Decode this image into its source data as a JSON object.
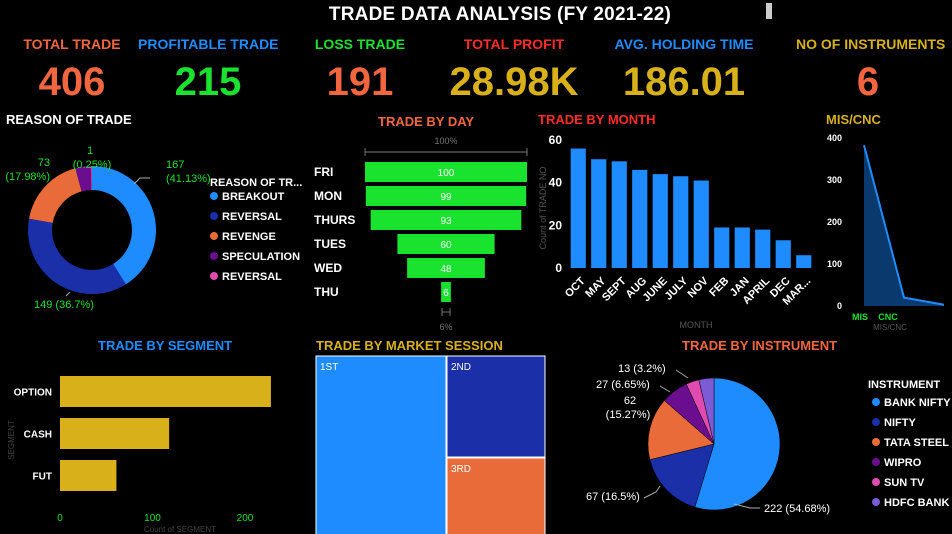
{
  "header": {
    "title": "TRADE DATA ANALYSIS (FY 2021-22)"
  },
  "kpis": [
    {
      "label": "TOTAL TRADE",
      "value": "406",
      "label_color": "#f2663f",
      "value_color": "#f2663f"
    },
    {
      "label": "PROFITABLE TRADE",
      "value": "215",
      "label_color": "#1e8cff",
      "value_color": "#19e32e"
    },
    {
      "label": "LOSS TRADE",
      "value": "191",
      "label_color": "#19e32e",
      "value_color": "#f2663f"
    },
    {
      "label": "TOTAL PROFIT",
      "value": "28.98K",
      "label_color": "#ff2b2b",
      "value_color": "#d8b11a"
    },
    {
      "label": "AVG. HOLDING TIME",
      "value": "186.01",
      "label_color": "#1e8cff",
      "value_color": "#d8b11a"
    },
    {
      "label": "NO OF INSTRUMENTS",
      "value": "6",
      "label_color": "#d8b11a",
      "value_color": "#f2663f"
    }
  ],
  "panels": {
    "reason_title": "REASON OF TRADE",
    "day_title": "TRADE BY DAY",
    "month_title": "TRADE BY MONTH",
    "mis_title": "MIS/CNC",
    "segment_title": "TRADE BY SEGMENT",
    "session_title": "TRADE BY MARKET SESSION",
    "instrument_title": "TRADE BY INSTRUMENT"
  },
  "chart_data": [
    {
      "id": "reason",
      "type": "pie",
      "title": "REASON OF TRADE",
      "legend_title": "REASON OF TR...",
      "slices": [
        {
          "name": "BREAKOUT",
          "value": 167,
          "label": "167 (41.13%)",
          "color": "#1e8cff"
        },
        {
          "name": "REVERSAL",
          "value": 149,
          "label": "149 (36.7%)",
          "color": "#1a2fa8"
        },
        {
          "name": "REVENGE",
          "value": 73,
          "label": "73 (17.98%)",
          "color": "#ea6b3a"
        },
        {
          "name": "SPECULATION",
          "value": 16,
          "label": "",
          "color": "#6a0d8f"
        },
        {
          "name": "REVERSAL",
          "value": 1,
          "label": "1 (0.25%)",
          "color": "#e04bb0"
        }
      ]
    },
    {
      "id": "day",
      "type": "bar",
      "title": "TRADE BY DAY",
      "top_label": "100%",
      "bottom_label": "6%",
      "categories": [
        "FRI",
        "MON",
        "THURS",
        "TUES",
        "WED",
        "THU"
      ],
      "values": [
        100,
        99,
        93,
        60,
        48,
        6
      ]
    },
    {
      "id": "month",
      "type": "bar",
      "title": "TRADE BY MONTH",
      "xlabel": "MONTH",
      "ylabel": "Count of TRADE NO",
      "ylim": [
        0,
        60
      ],
      "yticks": [
        "0",
        "20",
        "40",
        "60"
      ],
      "categories": [
        "OCT",
        "MAY",
        "SEPT",
        "AUG",
        "JUNE",
        "JULY",
        "NOV",
        "FEB",
        "JAN",
        "APRIL",
        "DEC",
        "MAR..."
      ],
      "values": [
        56,
        51,
        50,
        46,
        44,
        43,
        41,
        19,
        19,
        18,
        13,
        6
      ]
    },
    {
      "id": "miscnc",
      "type": "area",
      "title": "MIS/CNC",
      "xlabel": "MIS/CNC",
      "ylim": [
        0,
        400
      ],
      "yticks": [
        "0",
        "100",
        "200",
        "300",
        "400"
      ],
      "categories": [
        "MIS",
        "CNC",
        ""
      ],
      "values": [
        383,
        20,
        3
      ]
    },
    {
      "id": "segment",
      "type": "bar",
      "title": "TRADE BY SEGMENT",
      "xlabel": "Count of SEGMENT",
      "ylabel": "SEGMENT",
      "xlim": [
        0,
        240
      ],
      "xticks": [
        "0",
        "100",
        "200"
      ],
      "categories": [
        "OPTION",
        "CASH",
        "FUT"
      ],
      "values": [
        228,
        118,
        61
      ]
    },
    {
      "id": "session",
      "type": "heatmap",
      "title": "TRADE BY MARKET SESSION",
      "cells": [
        {
          "name": "1ST",
          "color": "#1e8cff"
        },
        {
          "name": "2ND",
          "color": "#1a2fa8"
        },
        {
          "name": "3RD",
          "color": "#ea6b3a"
        }
      ]
    },
    {
      "id": "instrument",
      "type": "pie",
      "title": "TRADE BY INSTRUMENT",
      "legend_title": "INSTRUMENT",
      "slices": [
        {
          "name": "BANK NIFTY",
          "value": 222,
          "label": "222 (54.68%)",
          "color": "#1e8cff"
        },
        {
          "name": "NIFTY",
          "value": 67,
          "label": "67 (16.5%)",
          "color": "#1a2fa8"
        },
        {
          "name": "TATA STEEL",
          "value": 62,
          "label": "62 (15.27%)",
          "color": "#ea6b3a"
        },
        {
          "name": "WIPRO",
          "value": 27,
          "label": "27 (6.65%)",
          "color": "#6a0d8f"
        },
        {
          "name": "SUN TV",
          "value": 13,
          "label": "13 (3.2%)",
          "color": "#e04bb0"
        },
        {
          "name": "HDFC BANK",
          "value": 15,
          "label": "",
          "color": "#7b5bd6"
        }
      ]
    }
  ]
}
